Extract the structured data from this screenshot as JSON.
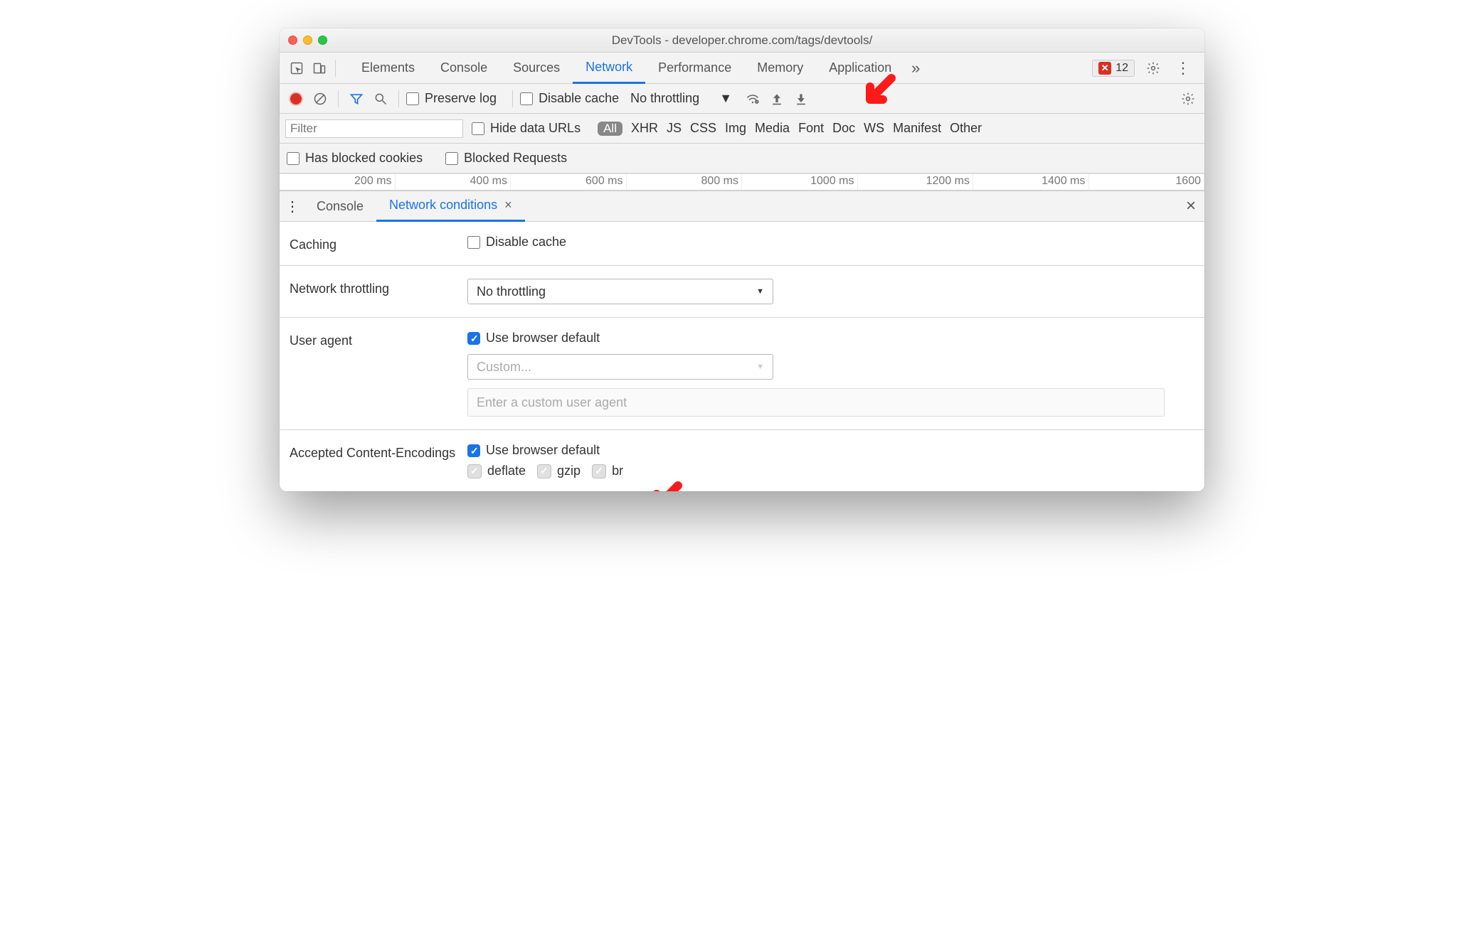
{
  "window": {
    "title": "DevTools - developer.chrome.com/tags/devtools/"
  },
  "mainTabs": {
    "items": [
      "Elements",
      "Console",
      "Sources",
      "Network",
      "Performance",
      "Memory",
      "Application"
    ],
    "active": "Network",
    "errorCount": "12"
  },
  "toolbar": {
    "preserveLog": "Preserve log",
    "disableCache": "Disable cache",
    "throttlingSelected": "No throttling"
  },
  "filterBar": {
    "placeholder": "Filter",
    "hideDataUrls": "Hide data URLs",
    "chipAll": "All",
    "types": [
      "XHR",
      "JS",
      "CSS",
      "Img",
      "Media",
      "Font",
      "Doc",
      "WS",
      "Manifest",
      "Other"
    ]
  },
  "checkBar": {
    "hasBlockedCookies": "Has blocked cookies",
    "blockedRequests": "Blocked Requests"
  },
  "timeline": {
    "ticks": [
      "200 ms",
      "400 ms",
      "600 ms",
      "800 ms",
      "1000 ms",
      "1200 ms",
      "1400 ms",
      "1600 "
    ]
  },
  "drawer": {
    "tabs": [
      "Console",
      "Network conditions"
    ],
    "active": "Network conditions"
  },
  "panel": {
    "caching": {
      "label": "Caching",
      "disableCache": "Disable cache"
    },
    "throttling": {
      "label": "Network throttling",
      "value": "No throttling"
    },
    "userAgent": {
      "label": "User agent",
      "useDefault": "Use browser default",
      "customPlaceholder": "Custom...",
      "inputPlaceholder": "Enter a custom user agent"
    },
    "encodings": {
      "label": "Accepted Content-Encodings",
      "useDefault": "Use browser default",
      "options": [
        "deflate",
        "gzip",
        "br"
      ]
    }
  }
}
